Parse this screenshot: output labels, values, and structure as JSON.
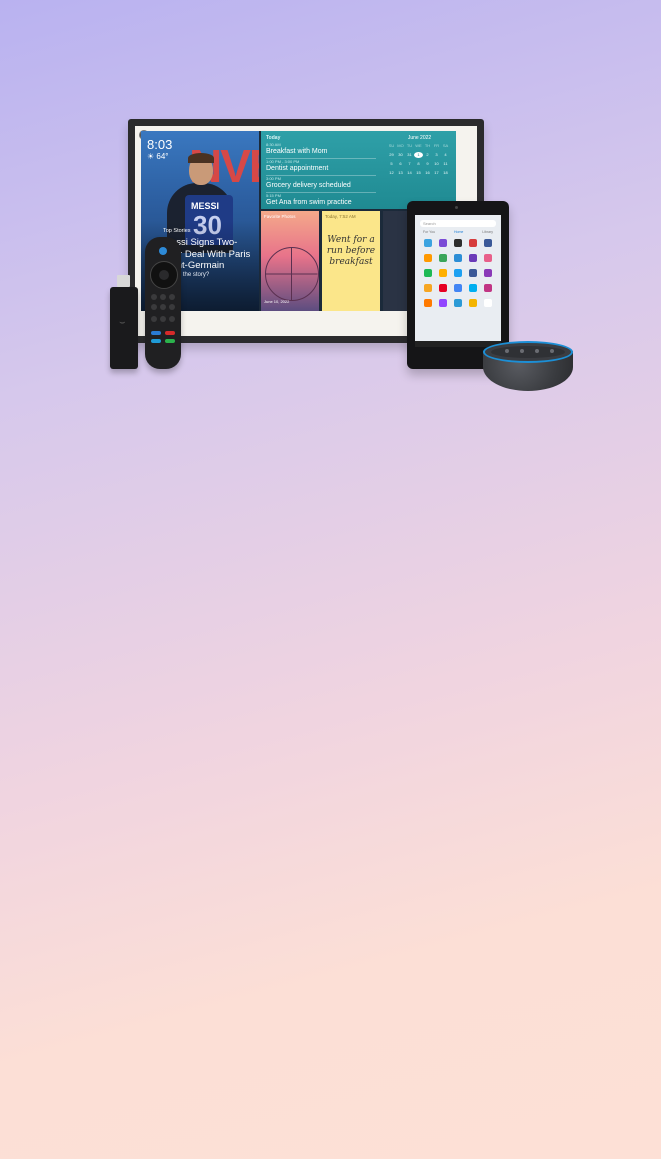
{
  "colors": {
    "background_top": "#b9b2f0",
    "background_bottom": "#fde0d6",
    "today_panel": "#2fa0a8",
    "note": "#fbe68a",
    "echo_ring": "#1c8fd6"
  },
  "echo_show": {
    "news": {
      "time": "8:03",
      "temp": "☀ 64°",
      "bg_text": "NVE",
      "tag": "Top Stories",
      "headline": "Messi Signs Two-Year Deal With Paris Saint-Germain",
      "cta": "What's the story?",
      "shirt_name": "MESSI",
      "shirt_number": "30"
    },
    "today": {
      "heading": "Today",
      "events": [
        {
          "time": "8:30 AM",
          "name": "Breakfast with Mom"
        },
        {
          "time": "1:00 PM - 3:00 PM",
          "name": "Dentist appointment"
        },
        {
          "time": "3:00 PM",
          "name": "Grocery delivery scheduled"
        },
        {
          "time": "5:15 PM",
          "name": "Get Ana from swim practice"
        }
      ],
      "calendar": {
        "title": "June 2022",
        "days": [
          "SU",
          "MO",
          "TU",
          "WE",
          "TH",
          "FR",
          "SA"
        ],
        "rows": [
          [
            "29",
            "30",
            "31",
            "1",
            "2",
            "3",
            "4"
          ],
          [
            "5",
            "6",
            "7",
            "8",
            "9",
            "10",
            "11"
          ],
          [
            "12",
            "13",
            "14",
            "15",
            "16",
            "17",
            "18"
          ]
        ],
        "selected": "2"
      }
    },
    "photos": {
      "label": "Favorite Photos",
      "date": "June 10, 2022"
    },
    "note": {
      "label": "Today, 7:52 AM",
      "text": "Went for a run before breakfast"
    }
  },
  "tablet": {
    "search_placeholder": "Search",
    "tabs": [
      "For You",
      "Home",
      "Library"
    ],
    "active_tab": "Home"
  }
}
